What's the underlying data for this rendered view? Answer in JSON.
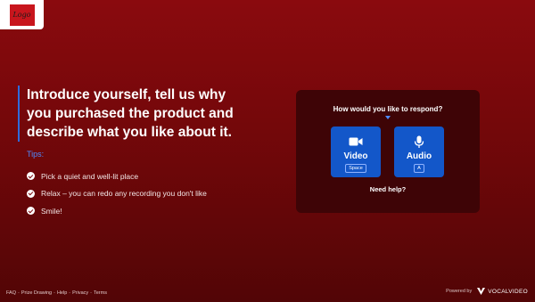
{
  "logo": {
    "text": "Logo"
  },
  "intro": {
    "headline": "Introduce yourself, tell us why you purchased the product and describe what you like about it.",
    "tips_label": "Tips:",
    "tips": [
      "Pick a quiet and well-lit place",
      "Relax – you can redo any recording you don't like",
      "Smile!"
    ]
  },
  "respond": {
    "question": "How would you like to respond?",
    "options": [
      {
        "label": "Video",
        "key": "Space",
        "icon": "video-camera-icon"
      },
      {
        "label": "Audio",
        "key": "A",
        "icon": "microphone-icon"
      }
    ],
    "help": "Need help?"
  },
  "footer": {
    "links": [
      "FAQ",
      "Prize Drawing",
      "Help",
      "Privacy",
      "Terms"
    ],
    "separator": "-",
    "powered_by": "Powered by",
    "brand": "VOCALVIDEO"
  },
  "colors": {
    "background_top": "#8a0a0e",
    "background_bottom": "#520506",
    "panel": "#3e0406",
    "accent_blue": "#1357c9",
    "tips_blue": "#4d8bff"
  }
}
